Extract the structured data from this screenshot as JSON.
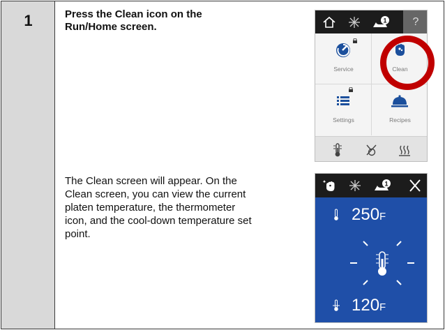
{
  "step": {
    "number": "1",
    "instruction": "Press the Clean icon on the Run/Home screen.",
    "description": "The Clean screen will appear. On the Clean screen, you can view the current platen temperature, the thermometer icon, and the cool-down temperature set point."
  },
  "home_screen": {
    "topbar": {
      "icons": [
        "home-icon",
        "snowflake-icon",
        "platen-alert-icon",
        "help-icon"
      ],
      "help_label": "?",
      "badge": "1"
    },
    "tiles": [
      {
        "label": "Service",
        "icon": "service-icon",
        "locked": true
      },
      {
        "label": "Clean",
        "icon": "clean-icon",
        "locked": false
      },
      {
        "label": "Settings",
        "icon": "settings-list-icon",
        "locked": true
      },
      {
        "label": "Recipes",
        "icon": "recipes-cloche-icon",
        "locked": false
      }
    ],
    "bottombar": {
      "icons": [
        "thermometer-icon",
        "probe-off-icon",
        "heat-icon"
      ]
    },
    "highlight_color": "#c00000"
  },
  "clean_screen": {
    "topbar": {
      "icons": [
        "clean-icon",
        "snowflake-icon",
        "platen-alert-icon",
        "close-icon"
      ],
      "badge": "1"
    },
    "current_temp": {
      "value": "250",
      "unit": "F"
    },
    "setpoint_temp": {
      "value": "120",
      "unit": "F"
    },
    "background_color": "#1f4fa8"
  }
}
